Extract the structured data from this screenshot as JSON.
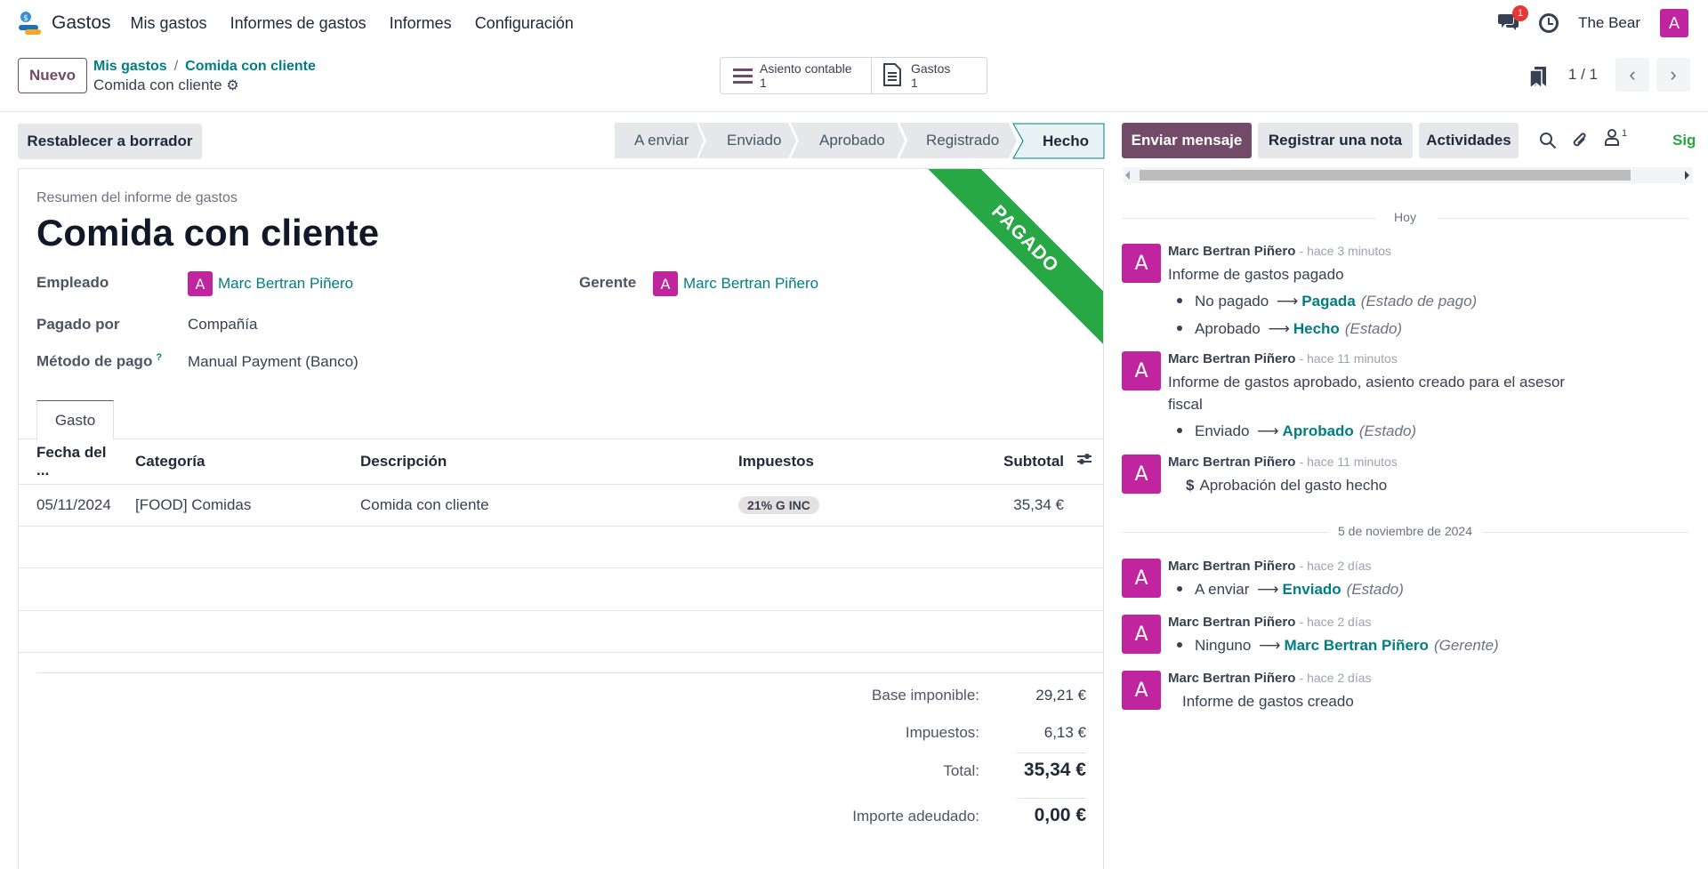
{
  "app": {
    "name": "Gastos"
  },
  "nav": {
    "items": [
      "Mis gastos",
      "Informes de gastos",
      "Informes",
      "Configuración"
    ],
    "messages_badge": "1",
    "company": "The Bear",
    "avatar_letter": "A"
  },
  "control": {
    "new_button": "Nuevo",
    "breadcrumb": [
      "Mis gastos",
      "Comida con cliente"
    ],
    "record_name": "Comida con cliente",
    "smart_buttons": [
      {
        "label": "Asiento contable",
        "count": "1",
        "icon": "list-icon"
      },
      {
        "label": "Gastos",
        "count": "1",
        "icon": "document-icon"
      }
    ],
    "pager": "1 / 1"
  },
  "status_bar": {
    "reset_button": "Restablecer a borrador",
    "stages": [
      "A enviar",
      "Enviado",
      "Aprobado",
      "Registrado",
      "Hecho"
    ],
    "active_stage": "Hecho"
  },
  "form": {
    "ribbon": "PAGADO",
    "summary_label": "Resumen del informe de gastos",
    "title": "Comida con cliente",
    "employee_label": "Empleado",
    "employee": "Marc Bertran Piñero",
    "manager_label": "Gerente",
    "manager": "Marc Bertran Piñero",
    "paid_by_label": "Pagado por",
    "paid_by": "Compañía",
    "payment_method_label": "Método de pago",
    "payment_method_help": "?",
    "payment_method": "Manual Payment (Banco)",
    "tab": "Gasto",
    "columns": [
      "Fecha del ...",
      "Categoría",
      "Descripción",
      "Impuestos",
      "Subtotal"
    ],
    "rows": [
      {
        "date": "05/11/2024",
        "category": "[FOOD] Comidas",
        "description": "Comida con cliente",
        "tax": "21% G INC",
        "subtotal": "35,34 €"
      }
    ],
    "totals": {
      "base_label": "Base imponible:",
      "base": "29,21 €",
      "tax_label": "Impuestos:",
      "tax": "6,13 €",
      "total_label": "Total:",
      "total": "35,34 €",
      "due_label": "Importe adeudado:",
      "due": "0,00 €"
    }
  },
  "chatter": {
    "send_message": "Enviar mensaje",
    "log_note": "Registrar una nota",
    "activities": "Actividades",
    "followers_count": "1",
    "follow": "Sig",
    "sep_today": "Hoy",
    "sep_date": "5 de noviembre de 2024",
    "messages": [
      {
        "author": "Marc Bertran Piñero",
        "date": "- hace 3 minutos",
        "body": "Informe de gastos pagado",
        "tracking": [
          {
            "old": "No pagado",
            "new": "Pagada",
            "field": "(Estado de pago)"
          },
          {
            "old": "Aprobado",
            "new": "Hecho",
            "field": "(Estado)"
          }
        ]
      },
      {
        "author": "Marc Bertran Piñero",
        "date": "- hace 11 minutos",
        "body": "Informe de gastos aprobado, asiento creado para el asesor fiscal",
        "tracking": [
          {
            "old": "Enviado",
            "new": "Aprobado",
            "field": "(Estado)"
          }
        ]
      },
      {
        "author": "Marc Bertran Piñero",
        "date": "- hace 11 minutos",
        "activity": "Aprobación del gasto hecho"
      },
      {
        "author": "Marc Bertran Piñero",
        "date": "- hace 2 días",
        "tracking": [
          {
            "old": "A enviar",
            "new": "Enviado",
            "field": "(Estado)"
          }
        ]
      },
      {
        "author": "Marc Bertran Piñero",
        "date": "- hace 2 días",
        "tracking": [
          {
            "old": "Ninguno",
            "new": "Marc Bertran Piñero",
            "field": "(Gerente)"
          }
        ]
      },
      {
        "author": "Marc Bertran Piñero",
        "date": "- hace 2 días",
        "body": "Informe de gastos creado"
      }
    ]
  },
  "colors": {
    "primary": "#714b67",
    "link": "#017e84",
    "ribbon": "#28a745",
    "avatar": "#c0249e"
  }
}
